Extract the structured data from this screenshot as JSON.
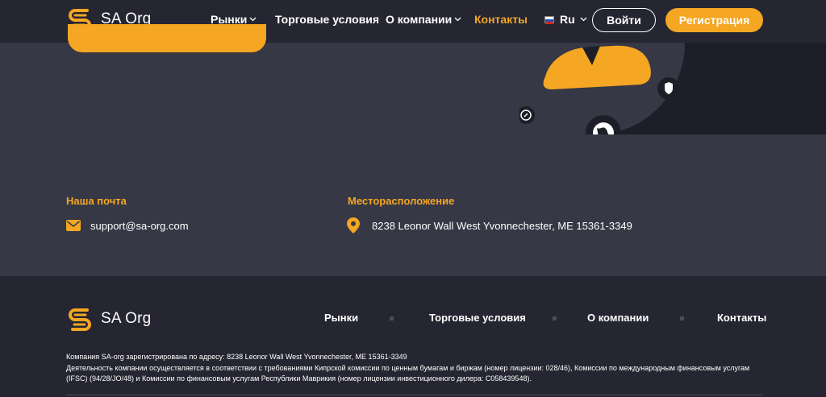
{
  "brand": {
    "name": "SA Org",
    "accent": "#f5a623",
    "header_bg": "#252631",
    "body_bg": "#363845"
  },
  "header": {
    "nav": [
      {
        "label": "Рынки",
        "has_dropdown": true
      },
      {
        "label": "Торговые условия",
        "has_dropdown": false
      },
      {
        "label": "О компании",
        "has_dropdown": true
      },
      {
        "label": "Контакты",
        "has_dropdown": false,
        "active": true
      }
    ],
    "language": {
      "label": "Ru",
      "icon": "russia-flag-icon"
    },
    "login_label": "Войти",
    "register_label": "Регистрация"
  },
  "contacts": {
    "email": {
      "label": "Наша почта",
      "value": "support@sa-org.com",
      "icon": "envelope-icon"
    },
    "location": {
      "label": "Месторасположение",
      "value": "8238 Leonor Wall West Yvonnechester, ME 15361-3349",
      "icon": "map-pin-icon"
    }
  },
  "footer": {
    "nav": [
      "Рынки",
      "Торговые условия",
      "О компании",
      "Контакты"
    ],
    "legal_1": "Компания SA-org зарегистрирована по адресу: 8238 Leonor Wall West Yvonnechester, ME 15361-3349",
    "legal_2": "Деятельность компании осуществляется в соответствии с требованиями Кипрской комиссии по ценным бумагам и биржам (номер лицензии: 028/46), Комиссии по международным финансовым услугам (IFSC) (94/28/JO/48) и Комиссии по финансовым услугам Республики Маврикия (номер лицензии инвестиционного дилера: C058439548)."
  }
}
